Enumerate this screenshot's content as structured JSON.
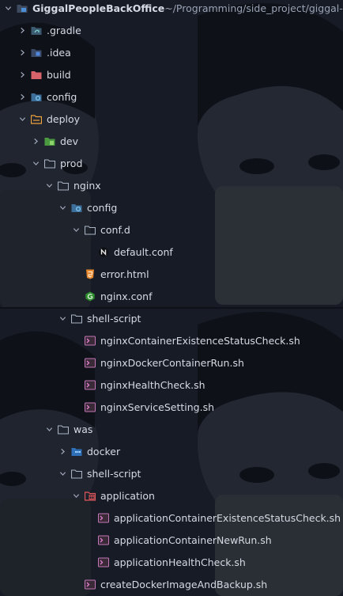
{
  "project": {
    "name": "GiggalPeopleBackOffice",
    "path": "~/Programming/side_project/giggal-pe"
  },
  "rows": [
    {
      "label": "GiggalPeopleBackOffice",
      "depth": 0,
      "chevron": "down",
      "icon": "module-folder-icon"
    },
    {
      "label": ".gradle",
      "depth": 1,
      "chevron": "right",
      "icon": "gradle-folder-icon"
    },
    {
      "label": ".idea",
      "depth": 1,
      "chevron": "right",
      "icon": "idea-folder-icon"
    },
    {
      "label": "build",
      "depth": 1,
      "chevron": "right",
      "icon": "build-folder-icon"
    },
    {
      "label": "config",
      "depth": 1,
      "chevron": "right",
      "icon": "config-folder-icon"
    },
    {
      "label": "deploy",
      "depth": 1,
      "chevron": "down",
      "icon": "deploy-folder-icon"
    },
    {
      "label": "dev",
      "depth": 2,
      "chevron": "right",
      "icon": "dev-folder-icon"
    },
    {
      "label": "prod",
      "depth": 2,
      "chevron": "down",
      "icon": "folder-icon"
    },
    {
      "label": "nginx",
      "depth": 3,
      "chevron": "down",
      "icon": "folder-icon"
    },
    {
      "label": "config",
      "depth": 4,
      "chevron": "down",
      "icon": "config-folder-icon"
    },
    {
      "label": "conf.d",
      "depth": 5,
      "chevron": "down",
      "icon": "folder-icon"
    },
    {
      "label": "default.conf",
      "depth": 6,
      "chevron": "none",
      "icon": "nginx-file-icon"
    },
    {
      "label": "error.html",
      "depth": 5,
      "chevron": "none",
      "icon": "html-file-icon"
    },
    {
      "label": "nginx.conf",
      "depth": 5,
      "chevron": "none",
      "icon": "nginx-conf-file-icon"
    },
    {
      "label": "shell-script",
      "depth": 4,
      "chevron": "down",
      "icon": "folder-icon"
    },
    {
      "label": "nginxContainerExistenceStatusCheck.sh",
      "depth": 5,
      "chevron": "none",
      "icon": "shell-file-icon"
    },
    {
      "label": "nginxDockerContainerRun.sh",
      "depth": 5,
      "chevron": "none",
      "icon": "shell-file-icon"
    },
    {
      "label": "nginxHealthCheck.sh",
      "depth": 5,
      "chevron": "none",
      "icon": "shell-file-icon"
    },
    {
      "label": "nginxServiceSetting.sh",
      "depth": 5,
      "chevron": "none",
      "icon": "shell-file-icon"
    },
    {
      "label": "was",
      "depth": 3,
      "chevron": "down",
      "icon": "folder-icon"
    },
    {
      "label": "docker",
      "depth": 4,
      "chevron": "right",
      "icon": "docker-folder-icon"
    },
    {
      "label": "shell-script",
      "depth": 4,
      "chevron": "down",
      "icon": "folder-icon"
    },
    {
      "label": "application",
      "depth": 5,
      "chevron": "down",
      "icon": "application-folder-icon"
    },
    {
      "label": "applicationContainerExistenceStatusCheck.sh",
      "depth": 6,
      "chevron": "none",
      "icon": "shell-file-icon"
    },
    {
      "label": "applicationContainerNewRun.sh",
      "depth": 6,
      "chevron": "none",
      "icon": "shell-file-icon"
    },
    {
      "label": "applicationHealthCheck.sh",
      "depth": 6,
      "chevron": "none",
      "icon": "shell-file-icon"
    },
    {
      "label": "createDockerImageAndBackup.sh",
      "depth": 5,
      "chevron": "none",
      "icon": "shell-file-icon"
    }
  ]
}
